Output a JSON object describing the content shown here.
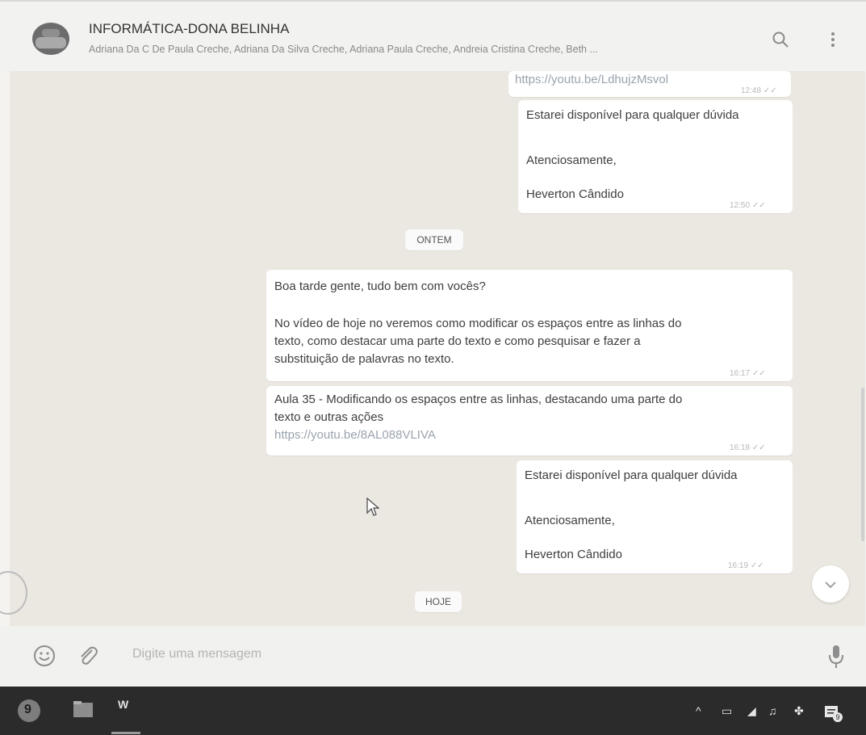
{
  "header": {
    "title": "INFORMÁTICA-DONA BELINHA",
    "participants": "Adriana Da C De Paula Creche, Adriana Da Silva Creche, Adriana Paula Creche, Andreia Cristina Creche, Beth ..."
  },
  "messages": [
    {
      "lines": [
        "https://youtu.be/LdhujzMsvol"
      ],
      "time": "12:48"
    },
    {
      "lines": [
        "Estarei disponível para qualquer dúvida",
        "Atenciosamente,",
        "Heverton Cândido"
      ],
      "time": "12:50"
    },
    {
      "lines": [
        "Boa tarde gente, tudo bem com vocês?",
        "No vídeo de hoje no veremos como modificar os espaços entre as linhas do",
        "texto, como destacar uma parte do texto e como pesquisar e fazer a",
        "substituição de palavras no texto."
      ],
      "time": "16:17"
    },
    {
      "lines": [
        "Aula 35 - Modificando os espaços entre as linhas, destacando uma parte do",
        "texto e outras ações",
        "https://youtu.be/8AL088VLIVA"
      ],
      "time": "16:18"
    },
    {
      "lines": [
        "Estarei disponível para qualquer dúvida",
        "Atenciosamente,",
        "Heverton Cândido"
      ],
      "time": "16:19"
    }
  ],
  "dates": {
    "yesterday": "ONTEM",
    "today": "HOJE"
  },
  "composer": {
    "placeholder": "Digite uma mensagem"
  },
  "taskbar": {
    "word_label": "W",
    "notification_count": "9"
  },
  "icons": {
    "search": "search-icon",
    "menu": "more-vertical-icon",
    "emoji": "emoji-icon",
    "attach": "paperclip-icon",
    "mic": "microphone-icon",
    "scroll": "chevron-down-icon"
  },
  "colors": {
    "chat_bg": "#ebe7e1",
    "bubble": "#ffffff",
    "taskbar": "#2b2b2b"
  }
}
